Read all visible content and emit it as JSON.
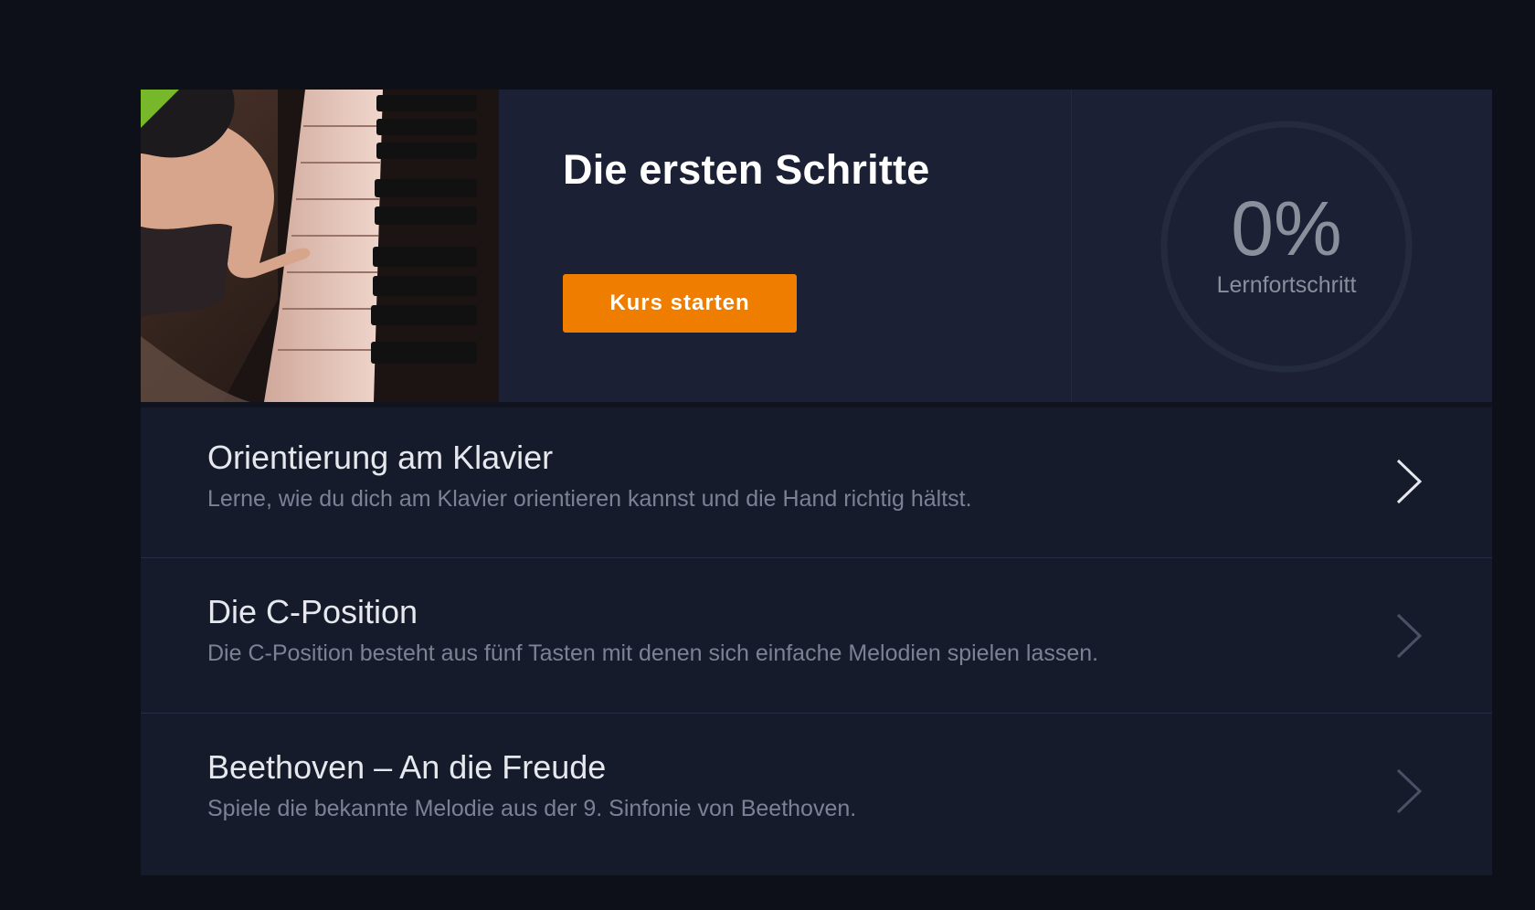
{
  "course": {
    "title": "Die ersten Schritte",
    "start_label": "Kurs starten",
    "progress_value": "0%",
    "progress_percent": 0,
    "progress_label": "Lernfortschritt",
    "thumbnail": "piano-hand-image",
    "colors": {
      "accent_button": "#ee7d00",
      "badge": "#77b82a",
      "background": "#0d1019",
      "card": "#161b2b"
    }
  },
  "lessons": [
    {
      "title": "Orientierung am Klavier",
      "description": "Lerne, wie du dich am Klavier orientieren kannst und die Hand richtig hältst.",
      "icon": "chevron-right-icon",
      "active": true
    },
    {
      "title": "Die C-Position",
      "description": "Die C-Position besteht aus fünf Tasten mit denen sich einfache Melodien spielen lassen.",
      "icon": "chevron-right-icon",
      "active": false
    },
    {
      "title": "Beethoven – An die Freude",
      "description": "Spiele die bekannte Melodie aus der 9. Sinfonie von Beethoven.",
      "icon": "chevron-right-icon",
      "active": false
    }
  ]
}
